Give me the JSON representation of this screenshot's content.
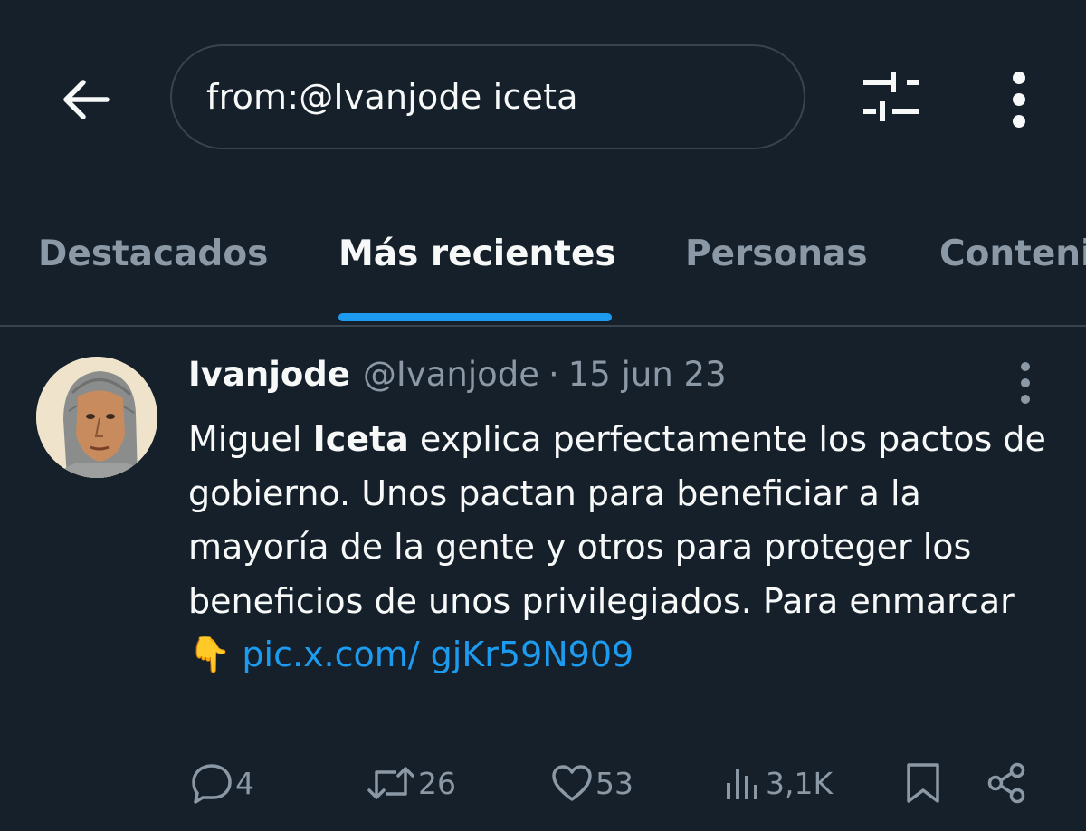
{
  "header": {
    "back_icon": "arrow-left-icon",
    "search_query": "from:@Ivanjode iceta",
    "filter_icon": "sliders-icon",
    "more_icon": "vertical-dots-icon"
  },
  "tabs": [
    {
      "label": "Destacados",
      "active": false
    },
    {
      "label": "Más recientes",
      "active": true
    },
    {
      "label": "Personas",
      "active": false
    },
    {
      "label": "Contenido",
      "active": false
    }
  ],
  "colors": {
    "background": "#15202b",
    "accent": "#1d9bf0",
    "text_primary": "#f7f9f9",
    "text_secondary": "#8b98a5",
    "divider": "#38444d"
  },
  "tweet": {
    "name": "Ivanjode",
    "handle": "@Ivanjode",
    "separator": "·",
    "date": "15 jun 23",
    "text_part1": "Miguel ",
    "text_highlight": "Iceta",
    "text_part2": " explica perfectamente los pactos de gobierno. Unos pactan para beneficiar a la mayoría de la gente y otros para proteger los beneficios de unos privilegiados. Para enmarcar ",
    "emoji": "👇",
    "link": "pic.x.com/ gjKr59N909",
    "actions": {
      "replies": "4",
      "retweets": "26",
      "likes": "53",
      "views": "3,1K"
    }
  }
}
